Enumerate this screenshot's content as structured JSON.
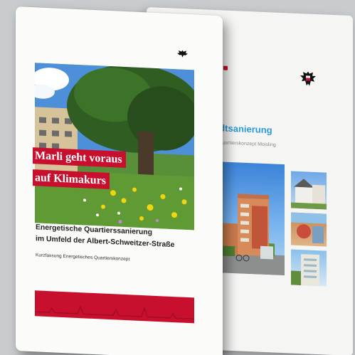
{
  "colors": {
    "accent_red": "#c8102e",
    "back_title_blue": "#2a9ad8",
    "background": "#c9ccce"
  },
  "icons": {
    "front_logo": "eagle-crest-icon",
    "back_logo": "eagle-crest-icon"
  },
  "front_brochure": {
    "banner_line_1": "Marli geht voraus",
    "banner_line_2": "auf Klimakurs",
    "heading_line_1": "Energetische Quartierssanierung",
    "heading_line_2": "im Umfeld der Albert-Schweitzer-Straße",
    "subtitle": "Kurzfassung Energetisches Quartierskonzept"
  },
  "back_brochure": {
    "title": "adtsanierung",
    "subtitle": "n Quartierskonzept Moisling"
  }
}
